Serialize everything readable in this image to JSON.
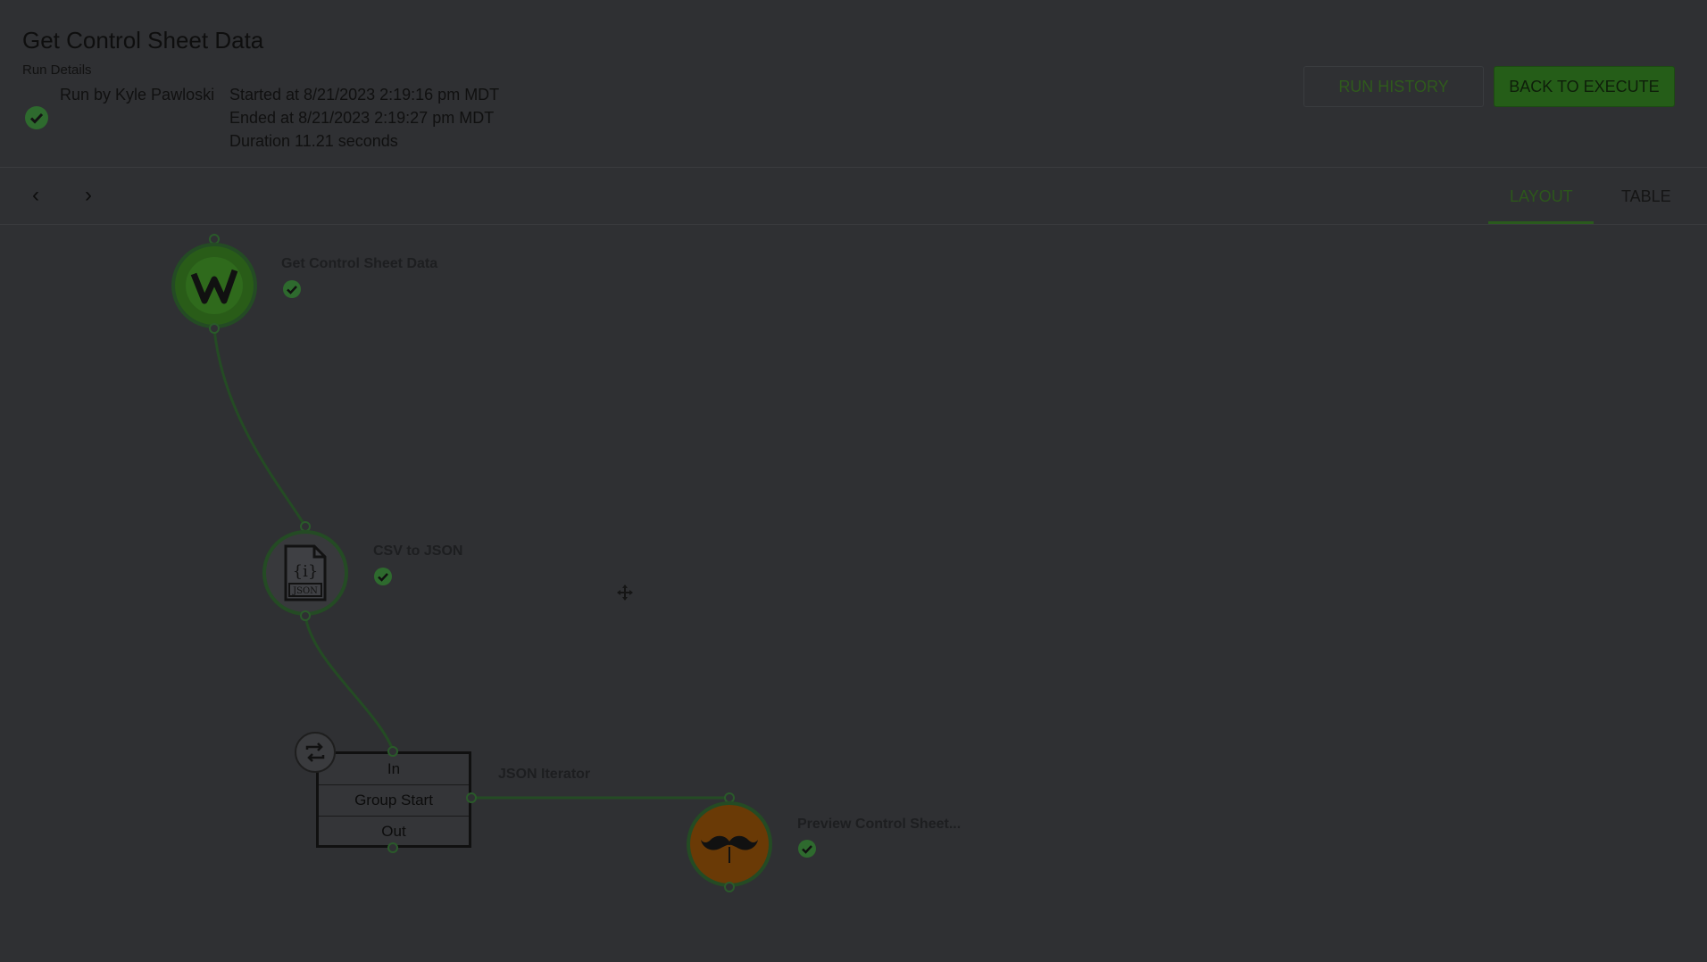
{
  "header": {
    "title": "Get Control Sheet Data",
    "subtitle": "Run Details",
    "run_by": "Run by Kyle Pawloski",
    "started": "Started at 8/21/2023 2:19:16 pm MDT",
    "ended": "Ended at 8/21/2023 2:19:27 pm MDT",
    "duration": "Duration 11.21 seconds",
    "status_icon": "check-circle-icon"
  },
  "actions": {
    "run_history": "RUN HISTORY",
    "back_to_execute": "BACK TO EXECUTE"
  },
  "toolbar": {
    "prev": "‹",
    "next": "›",
    "tabs": [
      {
        "label": "LAYOUT",
        "active": true
      },
      {
        "label": "TABLE",
        "active": false
      }
    ]
  },
  "nodes": {
    "get_control": {
      "label": "Get Control Sheet Data",
      "status": "success",
      "icon": "workiva-w-icon"
    },
    "csv_to_json": {
      "label": "CSV to JSON",
      "status": "success",
      "icon": "json-file-icon"
    },
    "json_iterator": {
      "label": "JSON Iterator",
      "rows": [
        "In",
        "Group Start",
        "Out"
      ],
      "icon": "loop-icon"
    },
    "preview": {
      "label": "Preview Control Sheet...",
      "status": "success",
      "icon": "mustache-icon"
    }
  },
  "colors": {
    "accent": "#2c571b",
    "success": "#2e6a2e",
    "overlay": "#2f3033"
  }
}
